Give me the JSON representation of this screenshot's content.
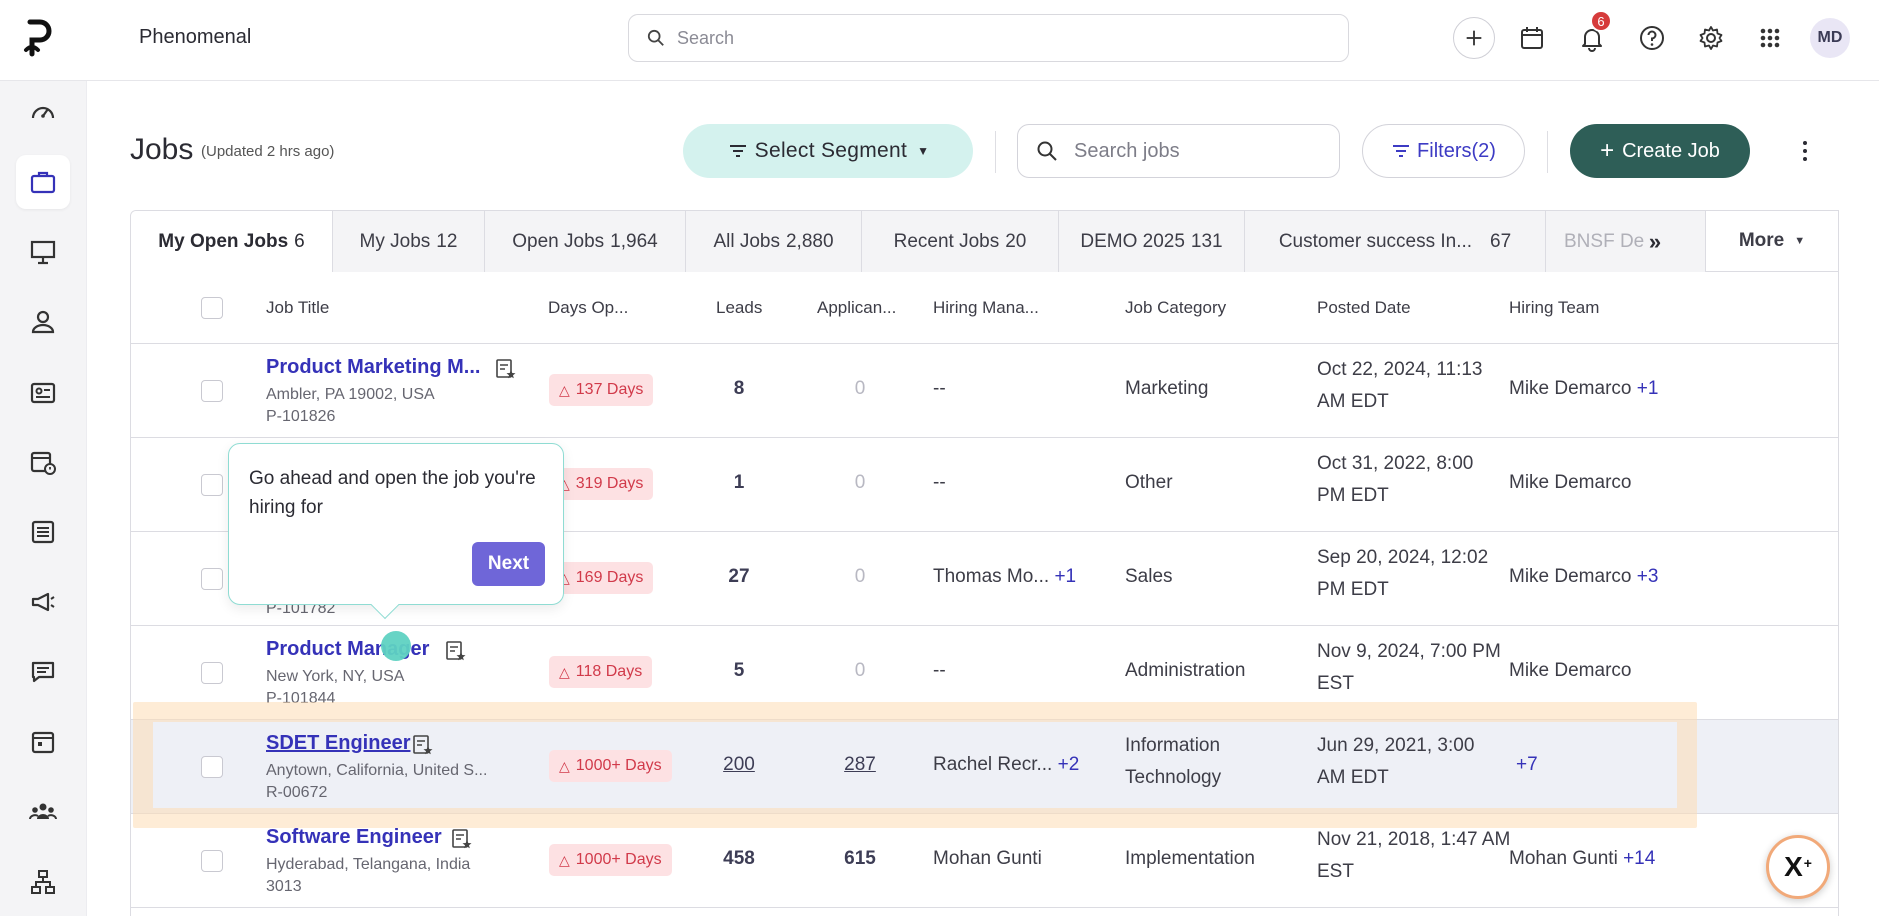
{
  "app": {
    "name": "Phenomenal",
    "logo_letter": "p"
  },
  "global_search": {
    "placeholder": "Search"
  },
  "topbar": {
    "notifications_count": "6",
    "avatar_initials": "MD"
  },
  "sidebar": {
    "items": [
      "dashboard",
      "jobs",
      "presentation",
      "person",
      "id-card",
      "calendar-clock",
      "list",
      "campaign",
      "messages",
      "calendar",
      "team",
      "org-chart"
    ],
    "active": "jobs"
  },
  "header": {
    "title": "Jobs",
    "updated": "(Updated 2 hrs ago)",
    "segment_label": "Select Segment",
    "search_placeholder": "Search jobs",
    "filters_label": "Filters(2)",
    "create_label": "Create Job"
  },
  "tabs": [
    {
      "label": "My Open Jobs",
      "count": "6"
    },
    {
      "label": "My Jobs",
      "count": "12"
    },
    {
      "label": "Open Jobs",
      "count": "1,964"
    },
    {
      "label": "All Jobs",
      "count": "2,880"
    },
    {
      "label": "Recent Jobs",
      "count": "20"
    },
    {
      "label": "DEMO 2025",
      "count": "131"
    },
    {
      "label": "Customer success In...",
      "count": "67"
    },
    {
      "label": "BNSF De",
      "count": ""
    }
  ],
  "more_label": "More",
  "table": {
    "columns": [
      "Job Title",
      "Days Op...",
      "Leads",
      "Applican...",
      "Hiring Mana...",
      "Job Category",
      "Posted Date",
      "Hiring Team"
    ],
    "rows": [
      {
        "title": "Product Marketing M...",
        "location": "Ambler, PA 19002, USA",
        "id": "P-101826",
        "days": "137 Days",
        "leads": "8",
        "applicants": "0",
        "manager": "--",
        "manager_more": "",
        "category": "Marketing",
        "posted_1": "Oct 22, 2024, 11:13",
        "posted_2": "AM EDT",
        "team": "Mike Demarco",
        "team_more": "+1"
      },
      {
        "title": "",
        "location": "",
        "id": "",
        "days": "319 Days",
        "leads": "1",
        "applicants": "0",
        "manager": "--",
        "manager_more": "",
        "category": "Other",
        "posted_1": "Oct 31, 2022, 8:00",
        "posted_2": "PM EDT",
        "team": "Mike Demarco",
        "team_more": ""
      },
      {
        "title": "",
        "location": "",
        "id": "P-101782",
        "days": "169 Days",
        "leads": "27",
        "applicants": "0",
        "manager": "Thomas Mo...",
        "manager_more": "+1",
        "category": "Sales",
        "posted_1": "Sep 20, 2024, 12:02",
        "posted_2": "PM EDT",
        "team": "Mike Demarco",
        "team_more": "+3"
      },
      {
        "title": "Product Manager",
        "location": "New York, NY, USA",
        "id": "P-101844",
        "days": "118 Days",
        "leads": "5",
        "applicants": "0",
        "manager": "--",
        "manager_more": "",
        "category": "Administration",
        "posted_1": "Nov 9, 2024, 7:00 PM",
        "posted_2": "EST",
        "team": "Mike Demarco",
        "team_more": ""
      },
      {
        "title": "SDET Engineer",
        "location": "Anytown, California, United S...",
        "id": "R-00672",
        "days": "1000+ Days",
        "leads": "200",
        "applicants": "287",
        "manager": "Rachel Recr...",
        "manager_more": "+2",
        "category_1": "Information",
        "category_2": "Technology",
        "posted_1": "Jun 29, 2021, 3:00",
        "posted_2": "AM EDT",
        "team": "",
        "team_more": "+7"
      },
      {
        "title": "Software Engineer",
        "location": "Hyderabad, Telangana, India",
        "id": "3013",
        "days": "1000+ Days",
        "leads": "458",
        "applicants": "615",
        "manager": "Mohan Gunti",
        "manager_more": "",
        "category": "Implementation",
        "posted_1": "Nov 21, 2018, 1:47 AM",
        "posted_2": "EST",
        "team": "Mohan Gunti",
        "team_more": "+14"
      }
    ]
  },
  "tooltip": {
    "text": "Go ahead and open the job you're hiring for",
    "next_label": "Next"
  },
  "assistant": {
    "label": "X",
    "superscript": "+"
  },
  "colors": {
    "primary": "#2e5e57",
    "link": "#3532b8",
    "segment_bg": "#d4f2ee",
    "badge_bg": "#fde1e3",
    "badge_text": "#d13a4a",
    "tooltip_button": "#6f66d8"
  }
}
